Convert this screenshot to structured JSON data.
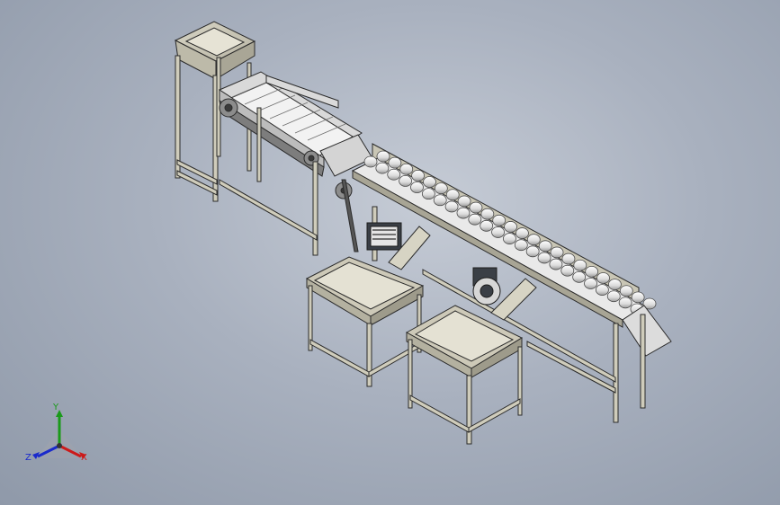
{
  "triad": {
    "x_label": "X",
    "y_label": "Y",
    "z_label": "Z",
    "x_color": "#cc1a1a",
    "y_color": "#1a9a1a",
    "z_color": "#1a2acc"
  },
  "colors": {
    "frame": "#c9c6b5",
    "frame_edge": "#2b2b2b",
    "belt": "#e6e6e6",
    "roller": "#f1f1f1",
    "motor": "#3a3f46",
    "bin_inner": "#e2dfd2"
  }
}
